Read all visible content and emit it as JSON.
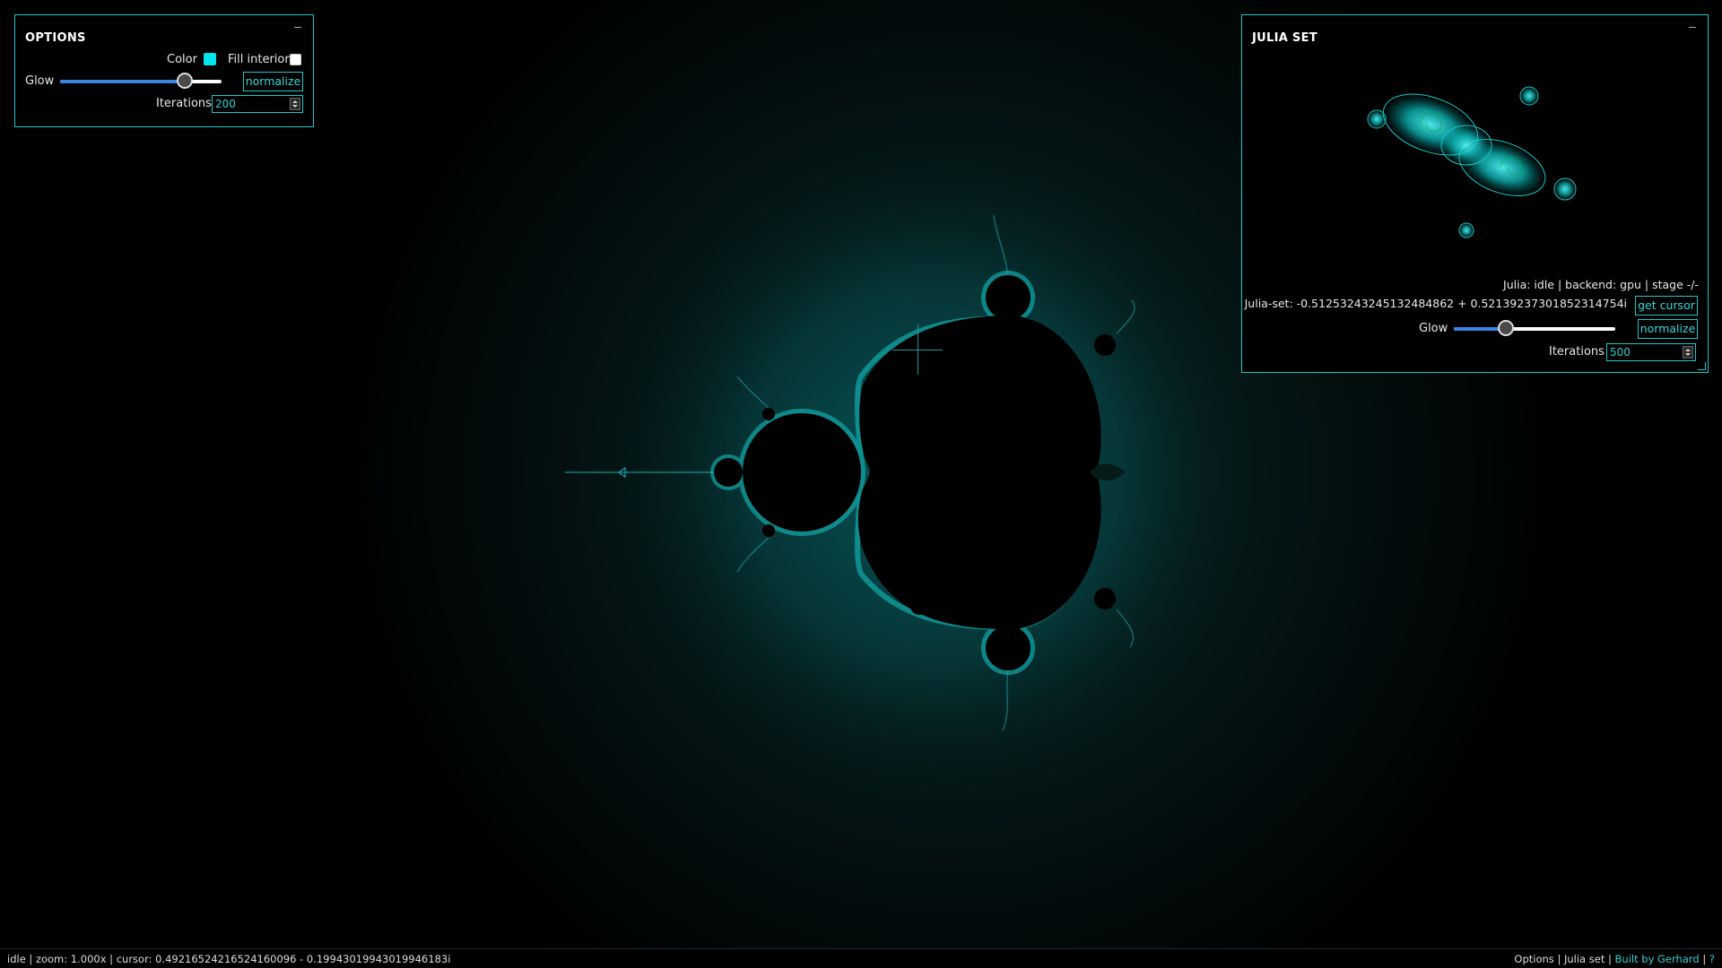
{
  "colors": {
    "accent": "#1ec8c8",
    "fractal_glow": "#00e5ee",
    "slider_fill": "#3a86e8",
    "background": "#000000"
  },
  "options": {
    "title": "OPTIONS",
    "color_label": "Color",
    "color_value": "#00e5ee",
    "fill_interior_label": "Fill interior",
    "fill_interior_checked": false,
    "glow_label": "Glow",
    "glow_level": 0.77,
    "normalize_label": "normalize",
    "iterations_label": "Iterations",
    "iterations_value": "200"
  },
  "julia": {
    "title": "JULIA SET",
    "status": "Julia: idle | backend: gpu | stage -/-",
    "julia_set_text": "Julia-set: -0.51253243245132484862 + 0.52139237301852314754i",
    "get_cursor_label": "get cursor",
    "glow_label": "Glow",
    "glow_level": 0.32,
    "normalize_label": "normalize",
    "iterations_label": "Iterations",
    "iterations_value": "500"
  },
  "statusbar": {
    "left_text": "idle | zoom: 1.000x | cursor: 0.49216524216524160096 - 0.19943019943019946183i",
    "options_link": "Options",
    "sep1": " | ",
    "julia_link": "Julia set",
    "sep2": " | ",
    "built_by_link": "Built by Gerhard",
    "sep3": " | ",
    "help_link": "?"
  },
  "icons": {
    "minimize": "minimize-icon",
    "crosshair": "crosshair-icon",
    "spinner": "spinner-icon"
  }
}
